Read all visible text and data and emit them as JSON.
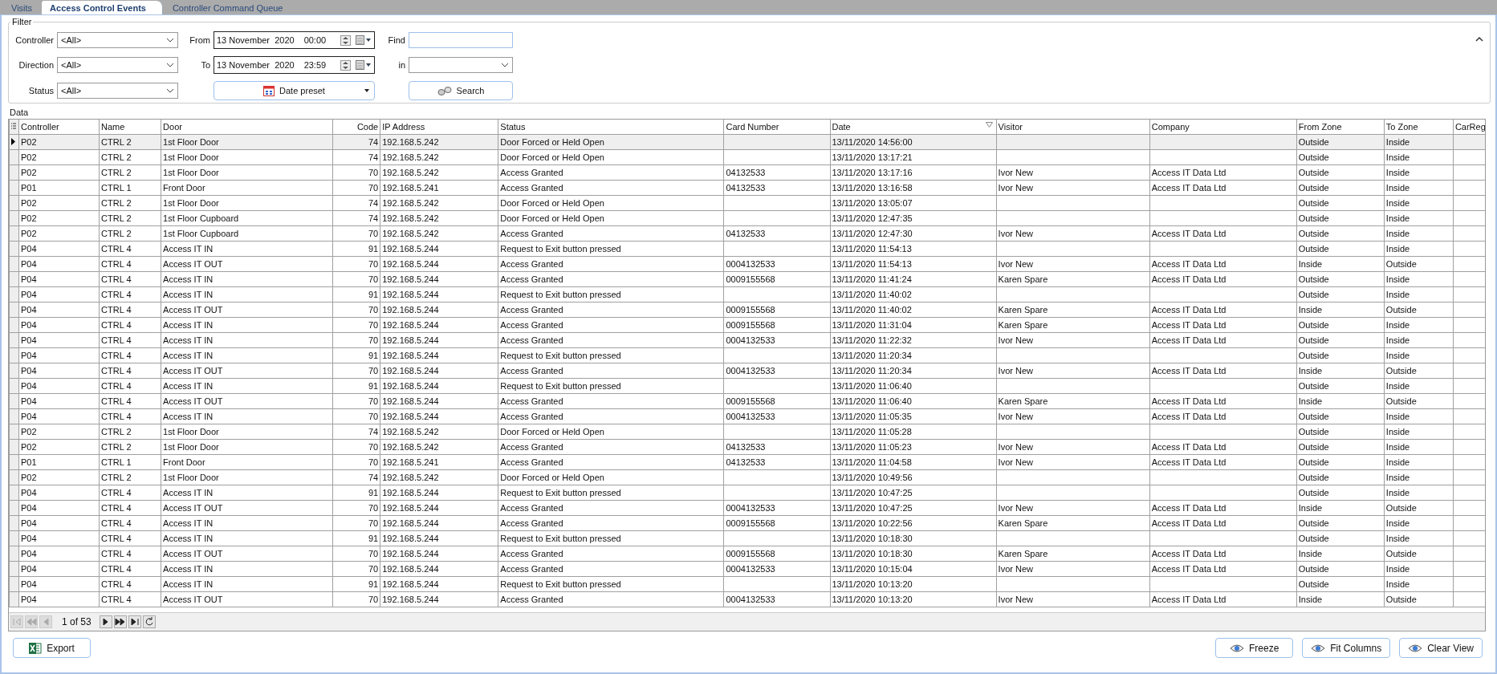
{
  "tabs": [
    {
      "label": "Visits",
      "selected": false
    },
    {
      "label": "Access Control Events",
      "selected": true
    },
    {
      "label": "Controller Command Queue",
      "selected": false
    }
  ],
  "filter": {
    "title": "Filter",
    "controller": {
      "label": "Controller",
      "value": "<All>"
    },
    "direction": {
      "label": "Direction",
      "value": "<All>"
    },
    "status": {
      "label": "Status",
      "value": "<All>"
    },
    "from": {
      "label": "From",
      "date": "13 November  2020",
      "time": "00:00"
    },
    "to": {
      "label": "To",
      "date": "13 November  2020",
      "time": "23:59"
    },
    "find": {
      "label": "Find"
    },
    "in": {
      "label": "in"
    },
    "date_preset_button": "Date preset",
    "search_button": "Search"
  },
  "data": {
    "title": "Data",
    "columns": [
      {
        "label": "Controller",
        "kind": "text",
        "sorted": false
      },
      {
        "label": "Name",
        "kind": "text",
        "sorted": false
      },
      {
        "label": "Door",
        "kind": "text",
        "sorted": false
      },
      {
        "label": "Code",
        "kind": "number",
        "sorted": false
      },
      {
        "label": "IP Address",
        "kind": "text",
        "sorted": false
      },
      {
        "label": "Status",
        "kind": "text",
        "sorted": false
      },
      {
        "label": "Card Number",
        "kind": "text",
        "sorted": false
      },
      {
        "label": "Date",
        "kind": "text",
        "sorted": true
      },
      {
        "label": "Visitor",
        "kind": "text",
        "sorted": false
      },
      {
        "label": "Company",
        "kind": "text",
        "sorted": false
      },
      {
        "label": "From Zone",
        "kind": "text",
        "sorted": false
      },
      {
        "label": "To Zone",
        "kind": "text",
        "sorted": false
      },
      {
        "label": "CarReg",
        "kind": "text",
        "sorted": false
      }
    ],
    "rows": [
      {
        "selected": true,
        "cells": [
          "P02",
          "CTRL 2",
          "1st Floor Door",
          "74",
          "192.168.5.242",
          "Door Forced or Held Open",
          null,
          "13/11/2020 14:56:00",
          null,
          null,
          "Outside",
          "Inside",
          null
        ]
      },
      {
        "selected": false,
        "cells": [
          "P02",
          "CTRL 2",
          "1st Floor Door",
          "74",
          "192.168.5.242",
          "Door Forced or Held Open",
          null,
          "13/11/2020 13:17:21",
          null,
          null,
          "Outside",
          "Inside",
          null
        ]
      },
      {
        "selected": false,
        "cells": [
          "P02",
          "CTRL 2",
          "1st Floor Door",
          "70",
          "192.168.5.242",
          "Access Granted",
          "04132533",
          "13/11/2020 13:17:16",
          "Ivor New",
          "Access IT Data Ltd",
          "Outside",
          "Inside",
          null
        ]
      },
      {
        "selected": false,
        "cells": [
          "P01",
          "CTRL 1",
          "Front Door",
          "70",
          "192.168.5.241",
          "Access Granted",
          "04132533",
          "13/11/2020 13:16:58",
          "Ivor New",
          "Access IT Data Ltd",
          "Outside",
          "Inside",
          null
        ]
      },
      {
        "selected": false,
        "cells": [
          "P02",
          "CTRL 2",
          "1st Floor Door",
          "74",
          "192.168.5.242",
          "Door Forced or Held Open",
          null,
          "13/11/2020 13:05:07",
          null,
          null,
          "Outside",
          "Inside",
          null
        ]
      },
      {
        "selected": false,
        "cells": [
          "P02",
          "CTRL 2",
          "1st Floor Cupboard",
          "74",
          "192.168.5.242",
          "Door Forced or Held Open",
          null,
          "13/11/2020 12:47:35",
          null,
          null,
          "Outside",
          "Inside",
          null
        ]
      },
      {
        "selected": false,
        "cells": [
          "P02",
          "CTRL 2",
          "1st Floor Cupboard",
          "70",
          "192.168.5.242",
          "Access Granted",
          "04132533",
          "13/11/2020 12:47:30",
          "Ivor New",
          "Access IT Data Ltd",
          "Outside",
          "Inside",
          null
        ]
      },
      {
        "selected": false,
        "cells": [
          "P04",
          "CTRL 4",
          "Access IT IN",
          "91",
          "192.168.5.244",
          "Request to Exit button pressed",
          null,
          "13/11/2020 11:54:13",
          null,
          null,
          "Outside",
          "Inside",
          null
        ]
      },
      {
        "selected": false,
        "cells": [
          "P04",
          "CTRL 4",
          "Access IT OUT",
          "70",
          "192.168.5.244",
          "Access Granted",
          "0004132533",
          "13/11/2020 11:54:13",
          "Ivor New",
          "Access IT Data Ltd",
          "Inside",
          "Outside",
          null
        ]
      },
      {
        "selected": false,
        "cells": [
          "P04",
          "CTRL 4",
          "Access IT IN",
          "70",
          "192.168.5.244",
          "Access Granted",
          "0009155568",
          "13/11/2020 11:41:24",
          "Karen Spare",
          "Access IT Data Ltd",
          "Outside",
          "Inside",
          null
        ]
      },
      {
        "selected": false,
        "cells": [
          "P04",
          "CTRL 4",
          "Access IT IN",
          "91",
          "192.168.5.244",
          "Request to Exit button pressed",
          null,
          "13/11/2020 11:40:02",
          null,
          null,
          "Outside",
          "Inside",
          null
        ]
      },
      {
        "selected": false,
        "cells": [
          "P04",
          "CTRL 4",
          "Access IT OUT",
          "70",
          "192.168.5.244",
          "Access Granted",
          "0009155568",
          "13/11/2020 11:40:02",
          "Karen Spare",
          "Access IT Data Ltd",
          "Inside",
          "Outside",
          null
        ]
      },
      {
        "selected": false,
        "cells": [
          "P04",
          "CTRL 4",
          "Access IT IN",
          "70",
          "192.168.5.244",
          "Access Granted",
          "0009155568",
          "13/11/2020 11:31:04",
          "Karen Spare",
          "Access IT Data Ltd",
          "Outside",
          "Inside",
          null
        ]
      },
      {
        "selected": false,
        "cells": [
          "P04",
          "CTRL 4",
          "Access IT IN",
          "70",
          "192.168.5.244",
          "Access Granted",
          "0004132533",
          "13/11/2020 11:22:32",
          "Ivor New",
          "Access IT Data Ltd",
          "Outside",
          "Inside",
          null
        ]
      },
      {
        "selected": false,
        "cells": [
          "P04",
          "CTRL 4",
          "Access IT IN",
          "91",
          "192.168.5.244",
          "Request to Exit button pressed",
          null,
          "13/11/2020 11:20:34",
          null,
          null,
          "Outside",
          "Inside",
          null
        ]
      },
      {
        "selected": false,
        "cells": [
          "P04",
          "CTRL 4",
          "Access IT OUT",
          "70",
          "192.168.5.244",
          "Access Granted",
          "0004132533",
          "13/11/2020 11:20:34",
          "Ivor New",
          "Access IT Data Ltd",
          "Inside",
          "Outside",
          null
        ]
      },
      {
        "selected": false,
        "cells": [
          "P04",
          "CTRL 4",
          "Access IT IN",
          "91",
          "192.168.5.244",
          "Request to Exit button pressed",
          null,
          "13/11/2020 11:06:40",
          null,
          null,
          "Outside",
          "Inside",
          null
        ]
      },
      {
        "selected": false,
        "cells": [
          "P04",
          "CTRL 4",
          "Access IT OUT",
          "70",
          "192.168.5.244",
          "Access Granted",
          "0009155568",
          "13/11/2020 11:06:40",
          "Karen Spare",
          "Access IT Data Ltd",
          "Inside",
          "Outside",
          null
        ]
      },
      {
        "selected": false,
        "cells": [
          "P04",
          "CTRL 4",
          "Access IT IN",
          "70",
          "192.168.5.244",
          "Access Granted",
          "0004132533",
          "13/11/2020 11:05:35",
          "Ivor New",
          "Access IT Data Ltd",
          "Outside",
          "Inside",
          null
        ]
      },
      {
        "selected": false,
        "cells": [
          "P02",
          "CTRL 2",
          "1st Floor Door",
          "74",
          "192.168.5.242",
          "Door Forced or Held Open",
          null,
          "13/11/2020 11:05:28",
          null,
          null,
          "Outside",
          "Inside",
          null
        ]
      },
      {
        "selected": false,
        "cells": [
          "P02",
          "CTRL 2",
          "1st Floor Door",
          "70",
          "192.168.5.242",
          "Access Granted",
          "04132533",
          "13/11/2020 11:05:23",
          "Ivor New",
          "Access IT Data Ltd",
          "Outside",
          "Inside",
          null
        ]
      },
      {
        "selected": false,
        "cells": [
          "P01",
          "CTRL 1",
          "Front Door",
          "70",
          "192.168.5.241",
          "Access Granted",
          "04132533",
          "13/11/2020 11:04:58",
          "Ivor New",
          "Access IT Data Ltd",
          "Outside",
          "Inside",
          null
        ]
      },
      {
        "selected": false,
        "cells": [
          "P02",
          "CTRL 2",
          "1st Floor Door",
          "74",
          "192.168.5.242",
          "Door Forced or Held Open",
          null,
          "13/11/2020 10:49:56",
          null,
          null,
          "Outside",
          "Inside",
          null
        ]
      },
      {
        "selected": false,
        "cells": [
          "P04",
          "CTRL 4",
          "Access IT IN",
          "91",
          "192.168.5.244",
          "Request to Exit button pressed",
          null,
          "13/11/2020 10:47:25",
          null,
          null,
          "Outside",
          "Inside",
          null
        ]
      },
      {
        "selected": false,
        "cells": [
          "P04",
          "CTRL 4",
          "Access IT OUT",
          "70",
          "192.168.5.244",
          "Access Granted",
          "0004132533",
          "13/11/2020 10:47:25",
          "Ivor New",
          "Access IT Data Ltd",
          "Inside",
          "Outside",
          null
        ]
      },
      {
        "selected": false,
        "cells": [
          "P04",
          "CTRL 4",
          "Access IT IN",
          "70",
          "192.168.5.244",
          "Access Granted",
          "0009155568",
          "13/11/2020 10:22:56",
          "Karen Spare",
          "Access IT Data Ltd",
          "Outside",
          "Inside",
          null
        ]
      },
      {
        "selected": false,
        "cells": [
          "P04",
          "CTRL 4",
          "Access IT IN",
          "91",
          "192.168.5.244",
          "Request to Exit button pressed",
          null,
          "13/11/2020 10:18:30",
          null,
          null,
          "Outside",
          "Inside",
          null
        ]
      },
      {
        "selected": false,
        "cells": [
          "P04",
          "CTRL 4",
          "Access IT OUT",
          "70",
          "192.168.5.244",
          "Access Granted",
          "0009155568",
          "13/11/2020 10:18:30",
          "Karen Spare",
          "Access IT Data Ltd",
          "Inside",
          "Outside",
          null
        ]
      },
      {
        "selected": false,
        "cells": [
          "P04",
          "CTRL 4",
          "Access IT IN",
          "70",
          "192.168.5.244",
          "Access Granted",
          "0004132533",
          "13/11/2020 10:15:04",
          "Ivor New",
          "Access IT Data Ltd",
          "Outside",
          "Inside",
          null
        ]
      },
      {
        "selected": false,
        "cells": [
          "P04",
          "CTRL 4",
          "Access IT IN",
          "91",
          "192.168.5.244",
          "Request to Exit button pressed",
          null,
          "13/11/2020 10:13:20",
          null,
          null,
          "Outside",
          "Inside",
          null
        ]
      },
      {
        "selected": false,
        "cells": [
          "P04",
          "CTRL 4",
          "Access IT OUT",
          "70",
          "192.168.5.244",
          "Access Granted",
          "0004132533",
          "13/11/2020 10:13:20",
          "Ivor New",
          "Access IT Data Ltd",
          "Inside",
          "Outside",
          null
        ]
      }
    ],
    "pager": {
      "text": "1 of 53",
      "buttons": [
        {
          "kind": "first",
          "disabled": true
        },
        {
          "kind": "prev-page",
          "disabled": true
        },
        {
          "kind": "prev",
          "disabled": true
        },
        {
          "kind": "next",
          "disabled": false
        },
        {
          "kind": "next-page",
          "disabled": false
        },
        {
          "kind": "last",
          "disabled": false
        },
        {
          "kind": "refresh",
          "disabled": false
        }
      ]
    }
  },
  "footer": {
    "export_button": "Export",
    "right_buttons": [
      "Freeze",
      "Fit Columns",
      "Clear View"
    ]
  }
}
